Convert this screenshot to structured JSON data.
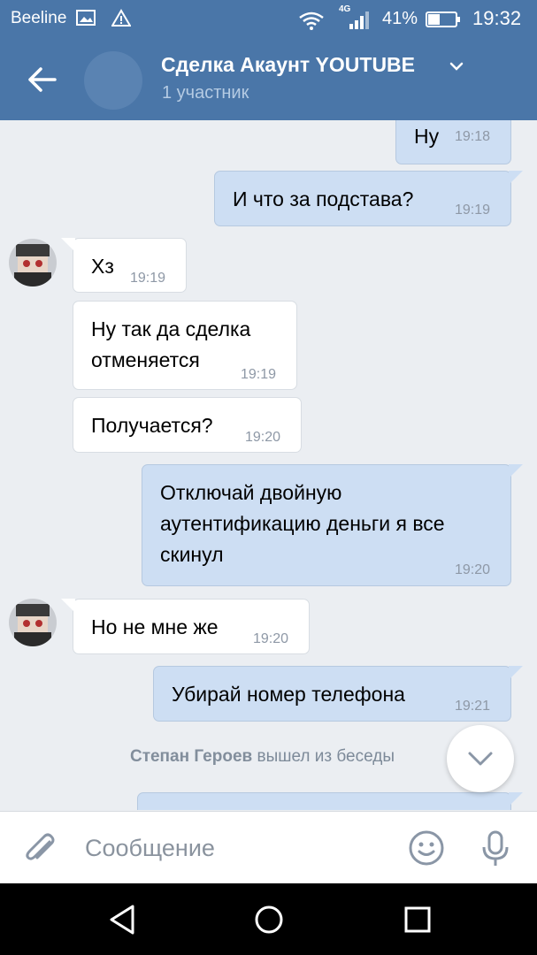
{
  "status_bar": {
    "carrier": "Beeline",
    "network": "4G",
    "battery": "41%",
    "time": "19:32",
    "icons": [
      "image-icon",
      "warning-icon",
      "wifi-icon",
      "signal-icon",
      "battery-icon"
    ]
  },
  "header": {
    "title": "Сделка Акаунт YOUTUBE",
    "subtitle": "1 участник"
  },
  "messages": [
    {
      "direction": "out",
      "text": "Ну",
      "time": "19:18"
    },
    {
      "direction": "out",
      "text": "И что за подстава?",
      "time": "19:19"
    },
    {
      "direction": "in",
      "text": "Хз",
      "time": "19:19"
    },
    {
      "direction": "in",
      "text": "Ну так да сделка\nотменяется",
      "time": "19:19"
    },
    {
      "direction": "in",
      "text": "Получается?",
      "time": "19:20"
    },
    {
      "direction": "out",
      "text": "Отключай двойную\nаутентификацию деньги я все\nскинул",
      "time": "19:20"
    },
    {
      "direction": "in",
      "text": "Но не мне же",
      "time": "19:20"
    },
    {
      "direction": "out",
      "text": "Убирай номер телефона",
      "time": "19:21"
    }
  ],
  "system_message": {
    "name": "Степан Героев",
    "text": "вышел из беседы"
  },
  "composer": {
    "placeholder": "Сообщение"
  },
  "colors": {
    "header": "#4a76a8",
    "outgoing_bubble": "#cddef3",
    "incoming_bubble": "#ffffff",
    "background": "#ebeef2"
  }
}
